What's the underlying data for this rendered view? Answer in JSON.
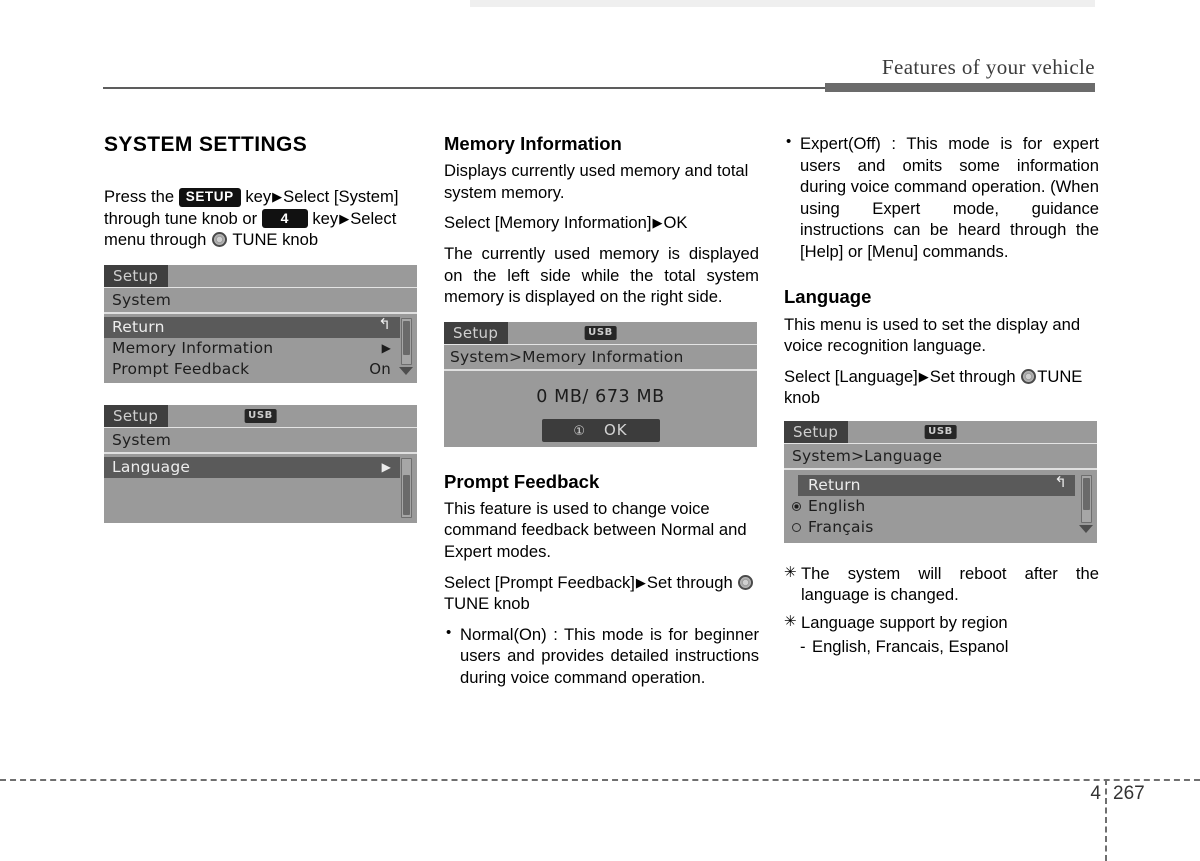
{
  "header": {
    "title": "Features of your vehicle"
  },
  "footer": {
    "chapter": "4",
    "page": "267"
  },
  "col1": {
    "section_title": "SYSTEM SETTINGS",
    "instruction": {
      "part1": "Press the ",
      "key_setup": "SETUP",
      "part2": " key",
      "arrow1": "▶",
      "part3": "Select [System] through tune knob or ",
      "key_num": "4",
      "part4": " key",
      "arrow2": "▶",
      "part5": "Select menu through ",
      "part6": " TUNE knob"
    },
    "device_system": {
      "tab": "Setup",
      "breadcrumb": "System",
      "rows": [
        {
          "label": "Return",
          "value": "↰",
          "highlight": true
        },
        {
          "label": "Memory Information",
          "value": "▶",
          "highlight": false
        },
        {
          "label": "Prompt Feedback",
          "value": "On",
          "highlight": false
        }
      ]
    },
    "device_language_menu": {
      "tab": "Setup",
      "usb": "USB",
      "breadcrumb": "System",
      "rows": [
        {
          "label": "Language",
          "value": "▶",
          "highlight": true
        }
      ]
    }
  },
  "col2": {
    "memory": {
      "title": "Memory Information",
      "p1": "Displays currently used memory and total system memory.",
      "p2_prefix": "Select [Memory Information]",
      "p2_arrow": "▶",
      "p2_suffix": "OK",
      "p3": "The currently used memory is displayed on the left side while the total system memory is displayed on the right side."
    },
    "device_memory": {
      "tab": "Setup",
      "usb": "USB",
      "breadcrumb": "System>Memory Information",
      "value": "0 MB/ 673 MB",
      "ok_circle": "①",
      "ok_label": "OK"
    },
    "prompt": {
      "title": "Prompt Feedback",
      "p1": "This feature is used to change voice command feedback between Normal and Expert modes.",
      "p2_prefix": "Select    [Prompt    Feedback]",
      "p2_arrow": "▶",
      "p2_mid": "Set through ",
      "p2_suffix": " TUNE knob",
      "bullet_normal": "Normal(On)  :  This  mode  is  for beginner   users   and   provides detailed  instructions  during  voice command operation."
    }
  },
  "col3": {
    "bullet_expert": "Expert(Off) : This mode is for expert users and omits some information during voice command operation. (When using Expert mode, guidance instructions can be heard through the [Help] or [Menu] commands.",
    "language": {
      "title": "Language",
      "p1": "This menu is used to set the display and voice recognition language.",
      "p2_prefix": "Select [Language]",
      "p2_arrow": "▶",
      "p2_mid": "Set through ",
      "p2_suffix": "TUNE knob"
    },
    "device_language": {
      "tab": "Setup",
      "usb": "USB",
      "breadcrumb": "System>Language",
      "rows": [
        {
          "label": "Return",
          "value": "↰",
          "highlight": true,
          "radio": "none"
        },
        {
          "label": "English",
          "value": "",
          "highlight": false,
          "radio": "on"
        },
        {
          "label": "Français",
          "value": "",
          "highlight": false,
          "radio": "off"
        }
      ]
    },
    "notes": [
      "The system will reboot after the language is changed.",
      "Language support by region"
    ],
    "note_dash": "English, Francais, Espanol"
  }
}
